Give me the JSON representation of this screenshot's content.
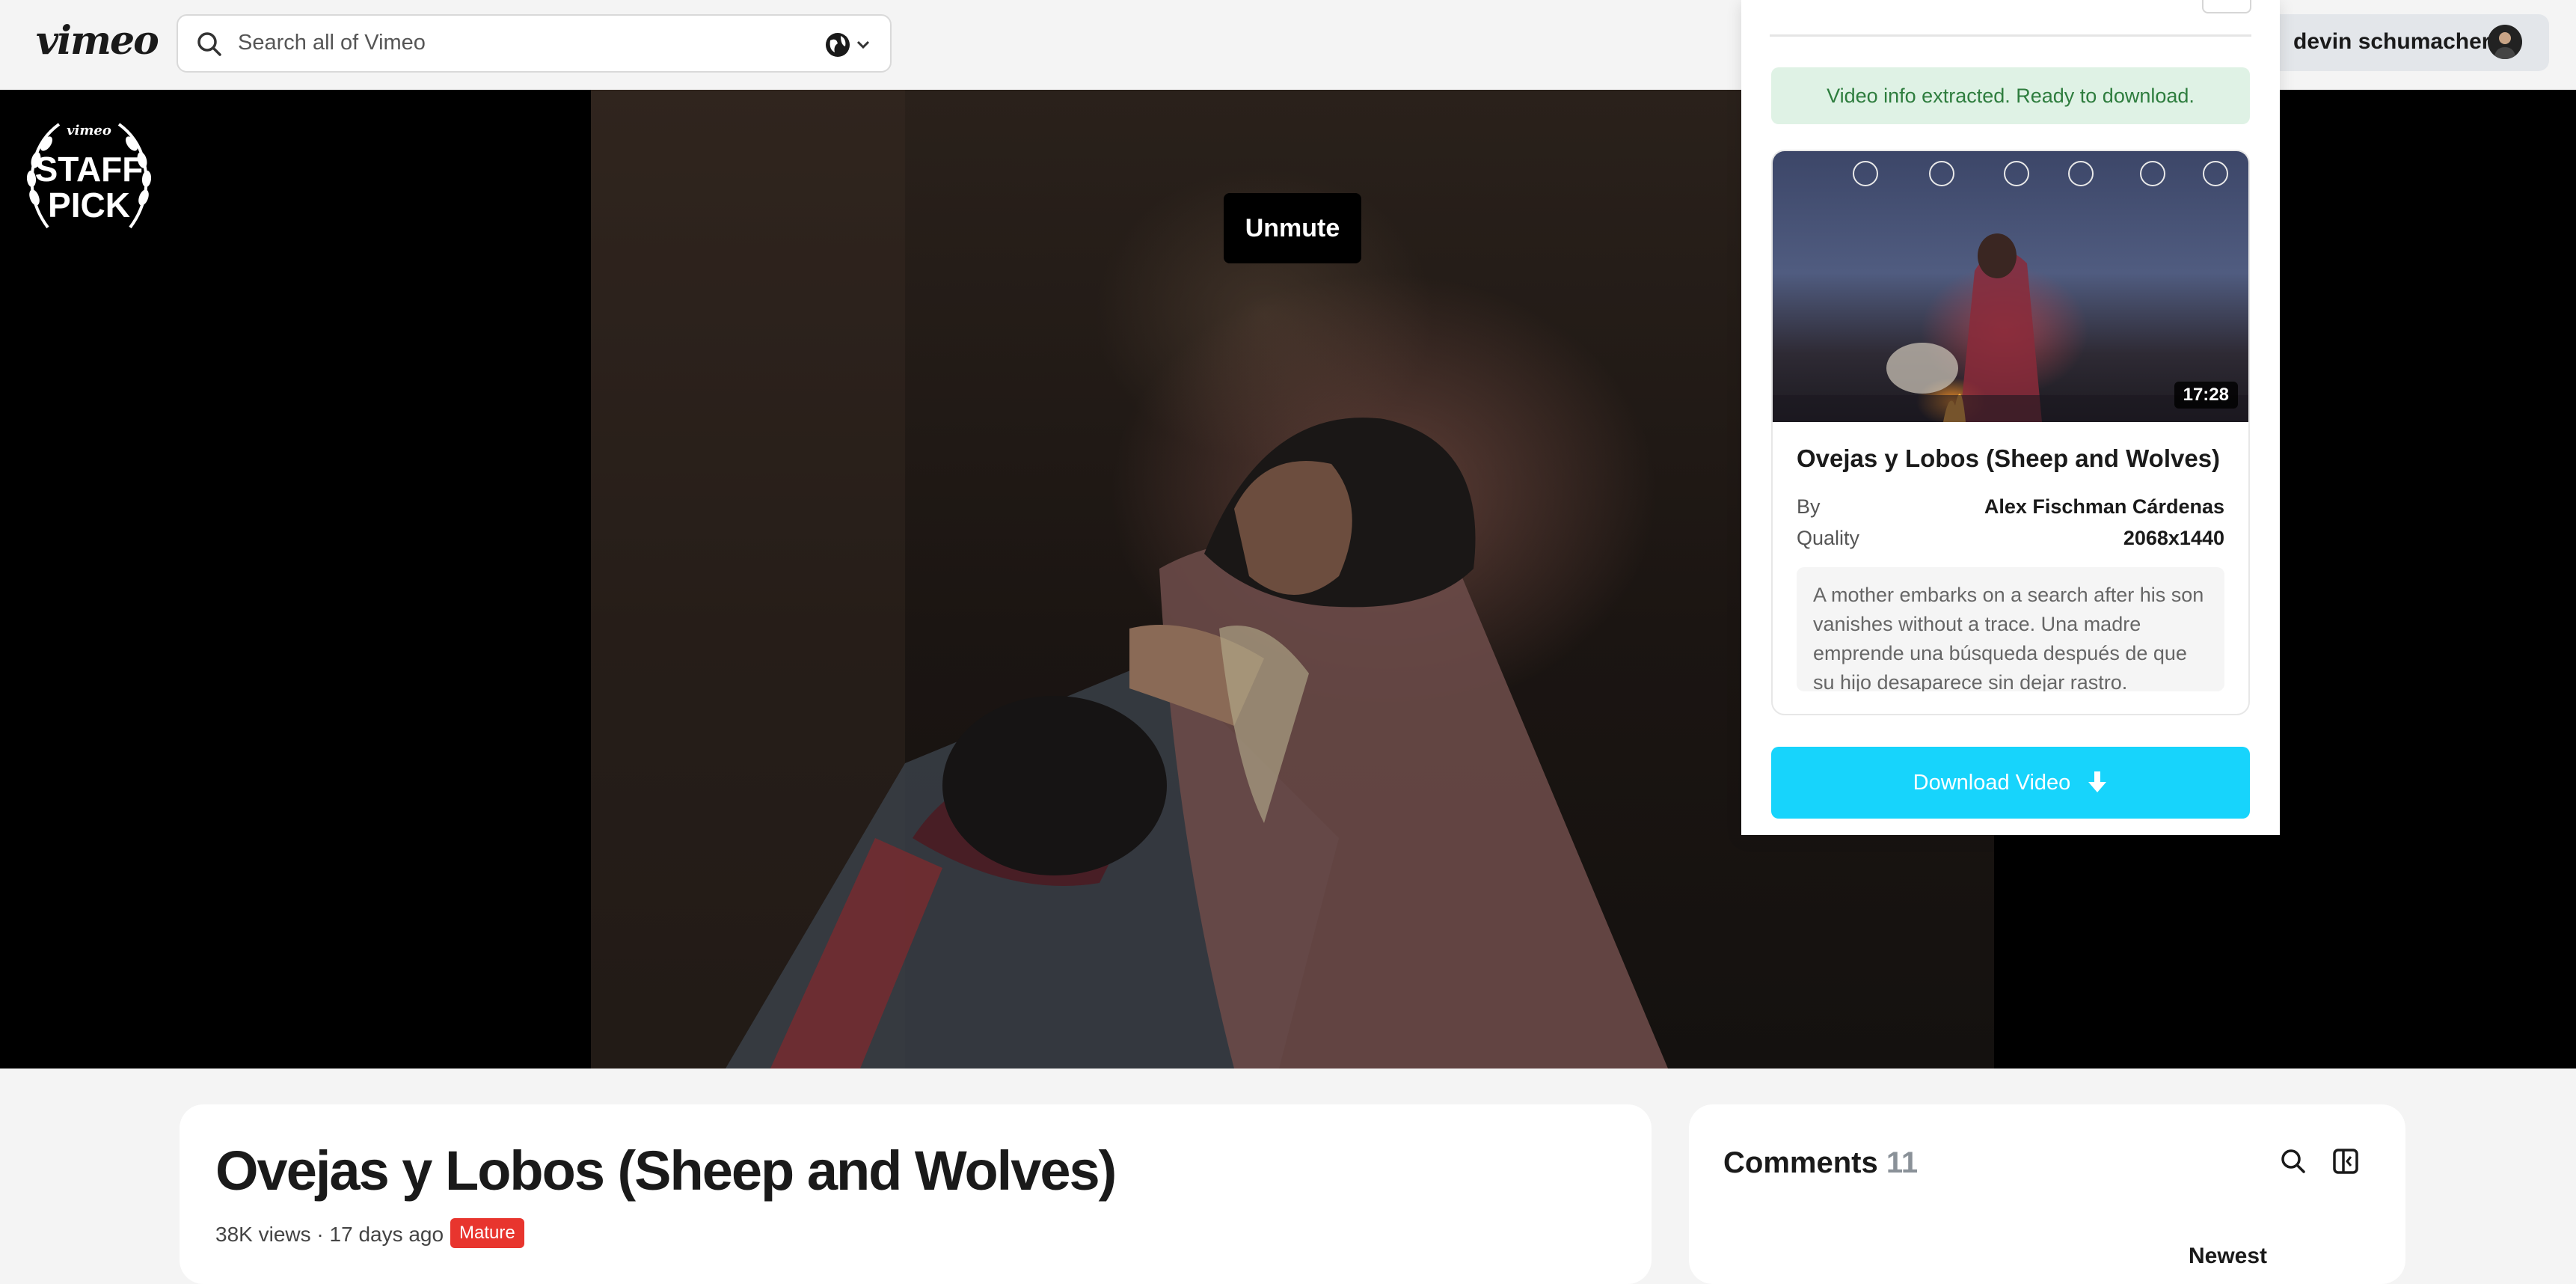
{
  "header": {
    "logo": "vimeo",
    "search_placeholder": "Search all of Vimeo",
    "user_name": "devin schumacher"
  },
  "player": {
    "unmute_label": "Unmute",
    "badge_brand": "vimeo",
    "badge_line1": "STAFF",
    "badge_line2": "PICK"
  },
  "video": {
    "title": "Ovejas y Lobos (Sheep and Wolves)",
    "views": "38K views",
    "age": "17 days ago",
    "rating_badge": "Mature"
  },
  "comments": {
    "label": "Comments",
    "count": "11",
    "sort_label": "Newest"
  },
  "extension": {
    "status": "Video info extracted. Ready to download.",
    "thumbnail_duration": "17:28",
    "video_title": "Ovejas y Lobos (Sheep and Wolves)",
    "by_label": "By",
    "by_value": "Alex Fischman Cárdenas",
    "quality_label": "Quality",
    "quality_value": "2068x1440",
    "description": "A mother embarks on a search after his son vanishes without a trace. Una madre emprende una búsqueda después de que su hijo desaparece sin dejar rastro.",
    "download_label": "Download Video"
  },
  "colors": {
    "download_button": "#17d4fc",
    "status_bg": "#dff2e5",
    "status_text": "#2e7d3e",
    "mature_badge": "#e8352e"
  },
  "icons": [
    "search-icon",
    "globe-icon",
    "chevron-down-icon",
    "avatar",
    "staff-pick-laurel-icon",
    "download-arrow-icon",
    "comments-search-icon",
    "comments-panel-icon"
  ]
}
